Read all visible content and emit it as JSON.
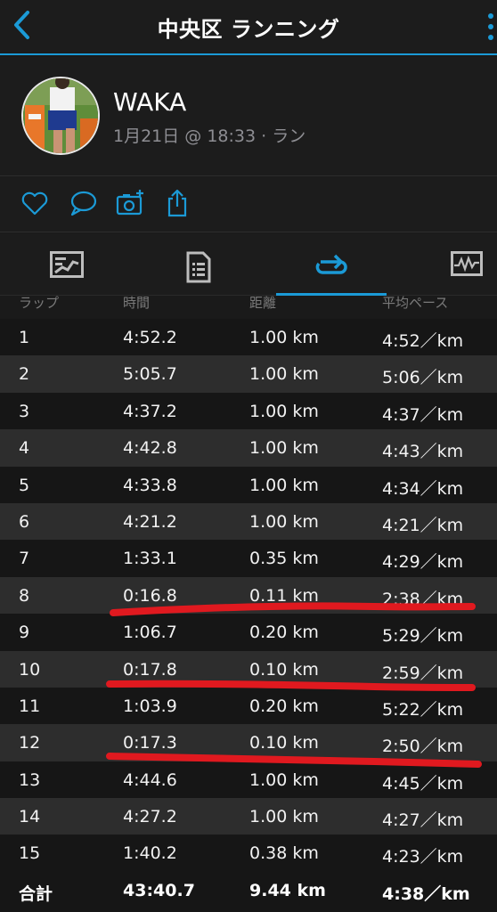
{
  "header": {
    "title": "中央区 ランニング"
  },
  "profile": {
    "name": "WAKA",
    "meta": "1月21日 @ 18:33 · ラン"
  },
  "table": {
    "headers": [
      "ラップ",
      "時間",
      "距離",
      "平均ペース"
    ],
    "rows": [
      [
        "1",
        "4:52.2",
        "1.00 km",
        "4:52／km"
      ],
      [
        "2",
        "5:05.7",
        "1.00 km",
        "5:06／km"
      ],
      [
        "3",
        "4:37.2",
        "1.00 km",
        "4:37／km"
      ],
      [
        "4",
        "4:42.8",
        "1.00 km",
        "4:43／km"
      ],
      [
        "5",
        "4:33.8",
        "1.00 km",
        "4:34／km"
      ],
      [
        "6",
        "4:21.2",
        "1.00 km",
        "4:21／km"
      ],
      [
        "7",
        "1:33.1",
        "0.35 km",
        "4:29／km"
      ],
      [
        "8",
        "0:16.8",
        "0.11 km",
        "2:38／km"
      ],
      [
        "9",
        "1:06.7",
        "0.20 km",
        "5:29／km"
      ],
      [
        "10",
        "0:17.8",
        "0.10 km",
        "2:59／km"
      ],
      [
        "11",
        "1:03.9",
        "0.20 km",
        "5:22／km"
      ],
      [
        "12",
        "0:17.3",
        "0.10 km",
        "2:50／km"
      ],
      [
        "13",
        "4:44.6",
        "1.00 km",
        "4:45／km"
      ],
      [
        "14",
        "4:27.2",
        "1.00 km",
        "4:27／km"
      ],
      [
        "15",
        "1:40.2",
        "0.38 km",
        "4:23／km"
      ]
    ],
    "total": [
      "合計",
      "43:40.7",
      "9.44 km",
      "4:38／km"
    ]
  },
  "icons": {
    "header": [
      "back-chevron-icon",
      "more-vertical-icon"
    ],
    "actions": [
      "heart-icon",
      "comment-icon",
      "add-photo-icon",
      "share-icon"
    ],
    "tabs": [
      "overview-icon",
      "details-icon",
      "laps-icon",
      "charts-icon"
    ]
  },
  "colors": {
    "accent": "#1b9ad6",
    "annotation": "#e0191f",
    "text_secondary": "#8e8e93"
  }
}
